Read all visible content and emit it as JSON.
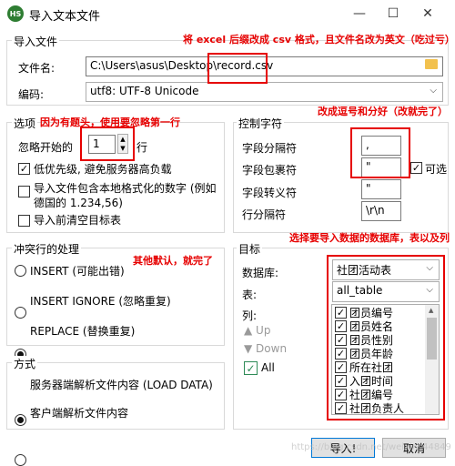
{
  "window": {
    "title": "导入文本文件",
    "app_icon": "HS"
  },
  "import_file": {
    "legend": "导入文件",
    "file_label": "文件名:",
    "file_value": "C:\\Users\\asus\\Desktop\\record.csv",
    "encoding_label": "编码:",
    "encoding_value": "utf8: UTF-8 Unicode"
  },
  "options": {
    "legend": "选项",
    "ignore_prefix": "忽略开始的",
    "ignore_value": "1",
    "ignore_suffix": "行",
    "low_priority": "低优先级, 避免服务器高负载",
    "localized_numbers": "导入文件包含本地格式化的数字 (例如德国的 1.234,56)",
    "clear_table": "导入前清空目标表"
  },
  "control_chars": {
    "legend": "控制字符",
    "field_sep_label": "字段分隔符",
    "field_sep_value": ",",
    "field_enclose_label": "字段包裹符",
    "field_enclose_value": "\"",
    "optional_label": "可选",
    "field_escape_label": "字段转义符",
    "field_escape_value": "\"",
    "line_sep_label": "行分隔符",
    "line_sep_value": "\\r\\n"
  },
  "conflict": {
    "legend": "冲突行的处理",
    "insert": "INSERT (可能出错)",
    "insert_ignore": "INSERT IGNORE (忽略重复)",
    "replace": "REPLACE (替换重复)"
  },
  "method": {
    "legend": "方式",
    "server": "服务器端解析文件内容 (LOAD DATA)",
    "client": "客户端解析文件内容"
  },
  "target": {
    "legend": "目标",
    "db_label": "数据库:",
    "db_value": "社团活动表",
    "table_label": "表:",
    "table_value": "all_table",
    "columns_label": "列:",
    "up": "Up",
    "down": "Down",
    "all": "All",
    "columns": [
      "团员编号",
      "团员姓名",
      "团员性别",
      "团员年龄",
      "所在社团",
      "入团时间",
      "社团编号",
      "社团负责人"
    ]
  },
  "buttons": {
    "import": "导入!",
    "cancel": "取消"
  },
  "annotations": {
    "file_note": "将 excel 后缀改成 csv 格式，且文件名改为英文（吃过亏）",
    "header_note": "因为有题头，使用要忽略第一行",
    "sep_note": "改成逗号和分好（改就完了）",
    "target_note": "选择要导入数据的数据库，表以及列",
    "default_note": "其他默认，就完了"
  },
  "watermark": "https://blog.csdn.net/weixin_44849"
}
